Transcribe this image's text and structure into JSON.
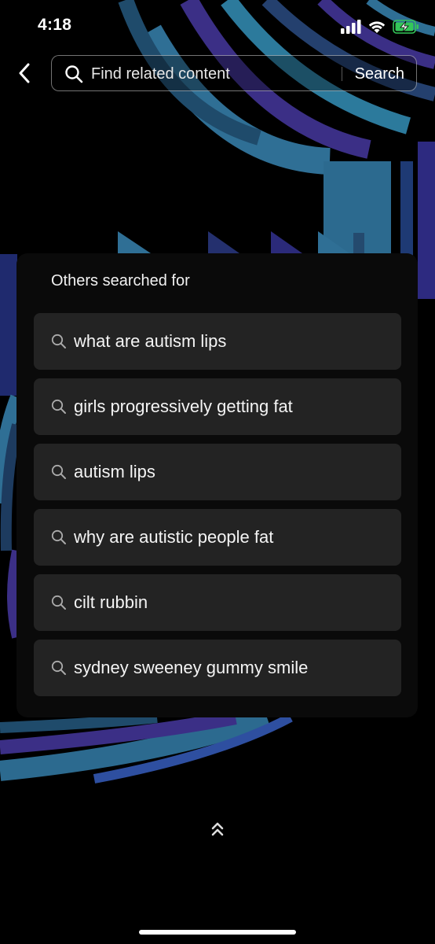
{
  "status_bar": {
    "time": "4:18",
    "icons": [
      "cellular-signal-icon",
      "wifi-icon",
      "battery-charging-icon"
    ],
    "battery_color": "#34c759"
  },
  "search": {
    "back_icon": "chevron-left-icon",
    "placeholder": "Find related content",
    "button_label": "Search"
  },
  "suggestions": {
    "title": "Others searched for",
    "items": [
      {
        "label": "what are autism lips"
      },
      {
        "label": "girls progressively getting fat"
      },
      {
        "label": "autism lips"
      },
      {
        "label": "why are autistic people fat"
      },
      {
        "label": "cilt rubbin"
      },
      {
        "label": "sydney sweeney gummy smile"
      }
    ]
  },
  "colors": {
    "background": "#000000",
    "panel": "#0a0a0a",
    "item_bg": "#232323",
    "wave_teal": "#2f6f95",
    "wave_purple": "#3b2f86"
  }
}
